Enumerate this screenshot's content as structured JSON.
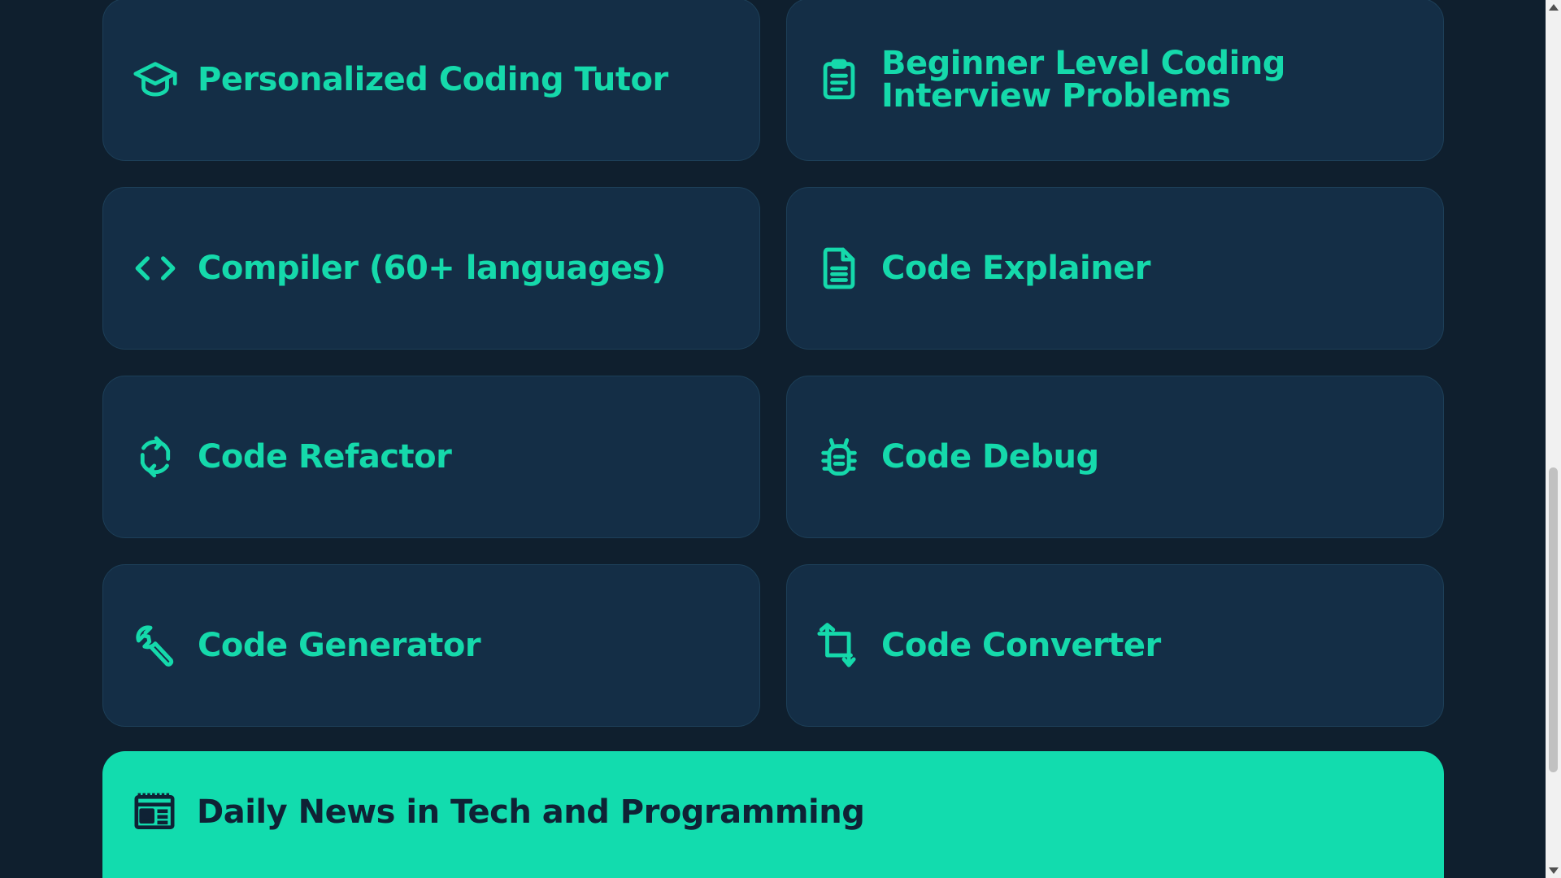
{
  "colors": {
    "page_background": "#0f1f2e",
    "card_background": "#142e46",
    "accent": "#15d9ab",
    "highlight_card_background": "#12dcae",
    "highlight_text": "#0f2235"
  },
  "cards": [
    {
      "label": "Personalized Coding Tutor",
      "icon": "graduation-cap-icon"
    },
    {
      "label": "Beginner Level Coding Interview Problems",
      "icon": "clipboard-icon"
    },
    {
      "label": "Compiler (60+ languages)",
      "icon": "code-brackets-icon"
    },
    {
      "label": "Code Explainer",
      "icon": "document-icon"
    },
    {
      "label": "Code Refactor",
      "icon": "refresh-icon"
    },
    {
      "label": "Code Debug",
      "icon": "bug-icon"
    },
    {
      "label": "Code Generator",
      "icon": "wrench-icon"
    },
    {
      "label": "Code Converter",
      "icon": "crop-convert-icon"
    }
  ],
  "featured": {
    "label": "Daily News in Tech and Programming",
    "icon": "newspaper-icon"
  }
}
